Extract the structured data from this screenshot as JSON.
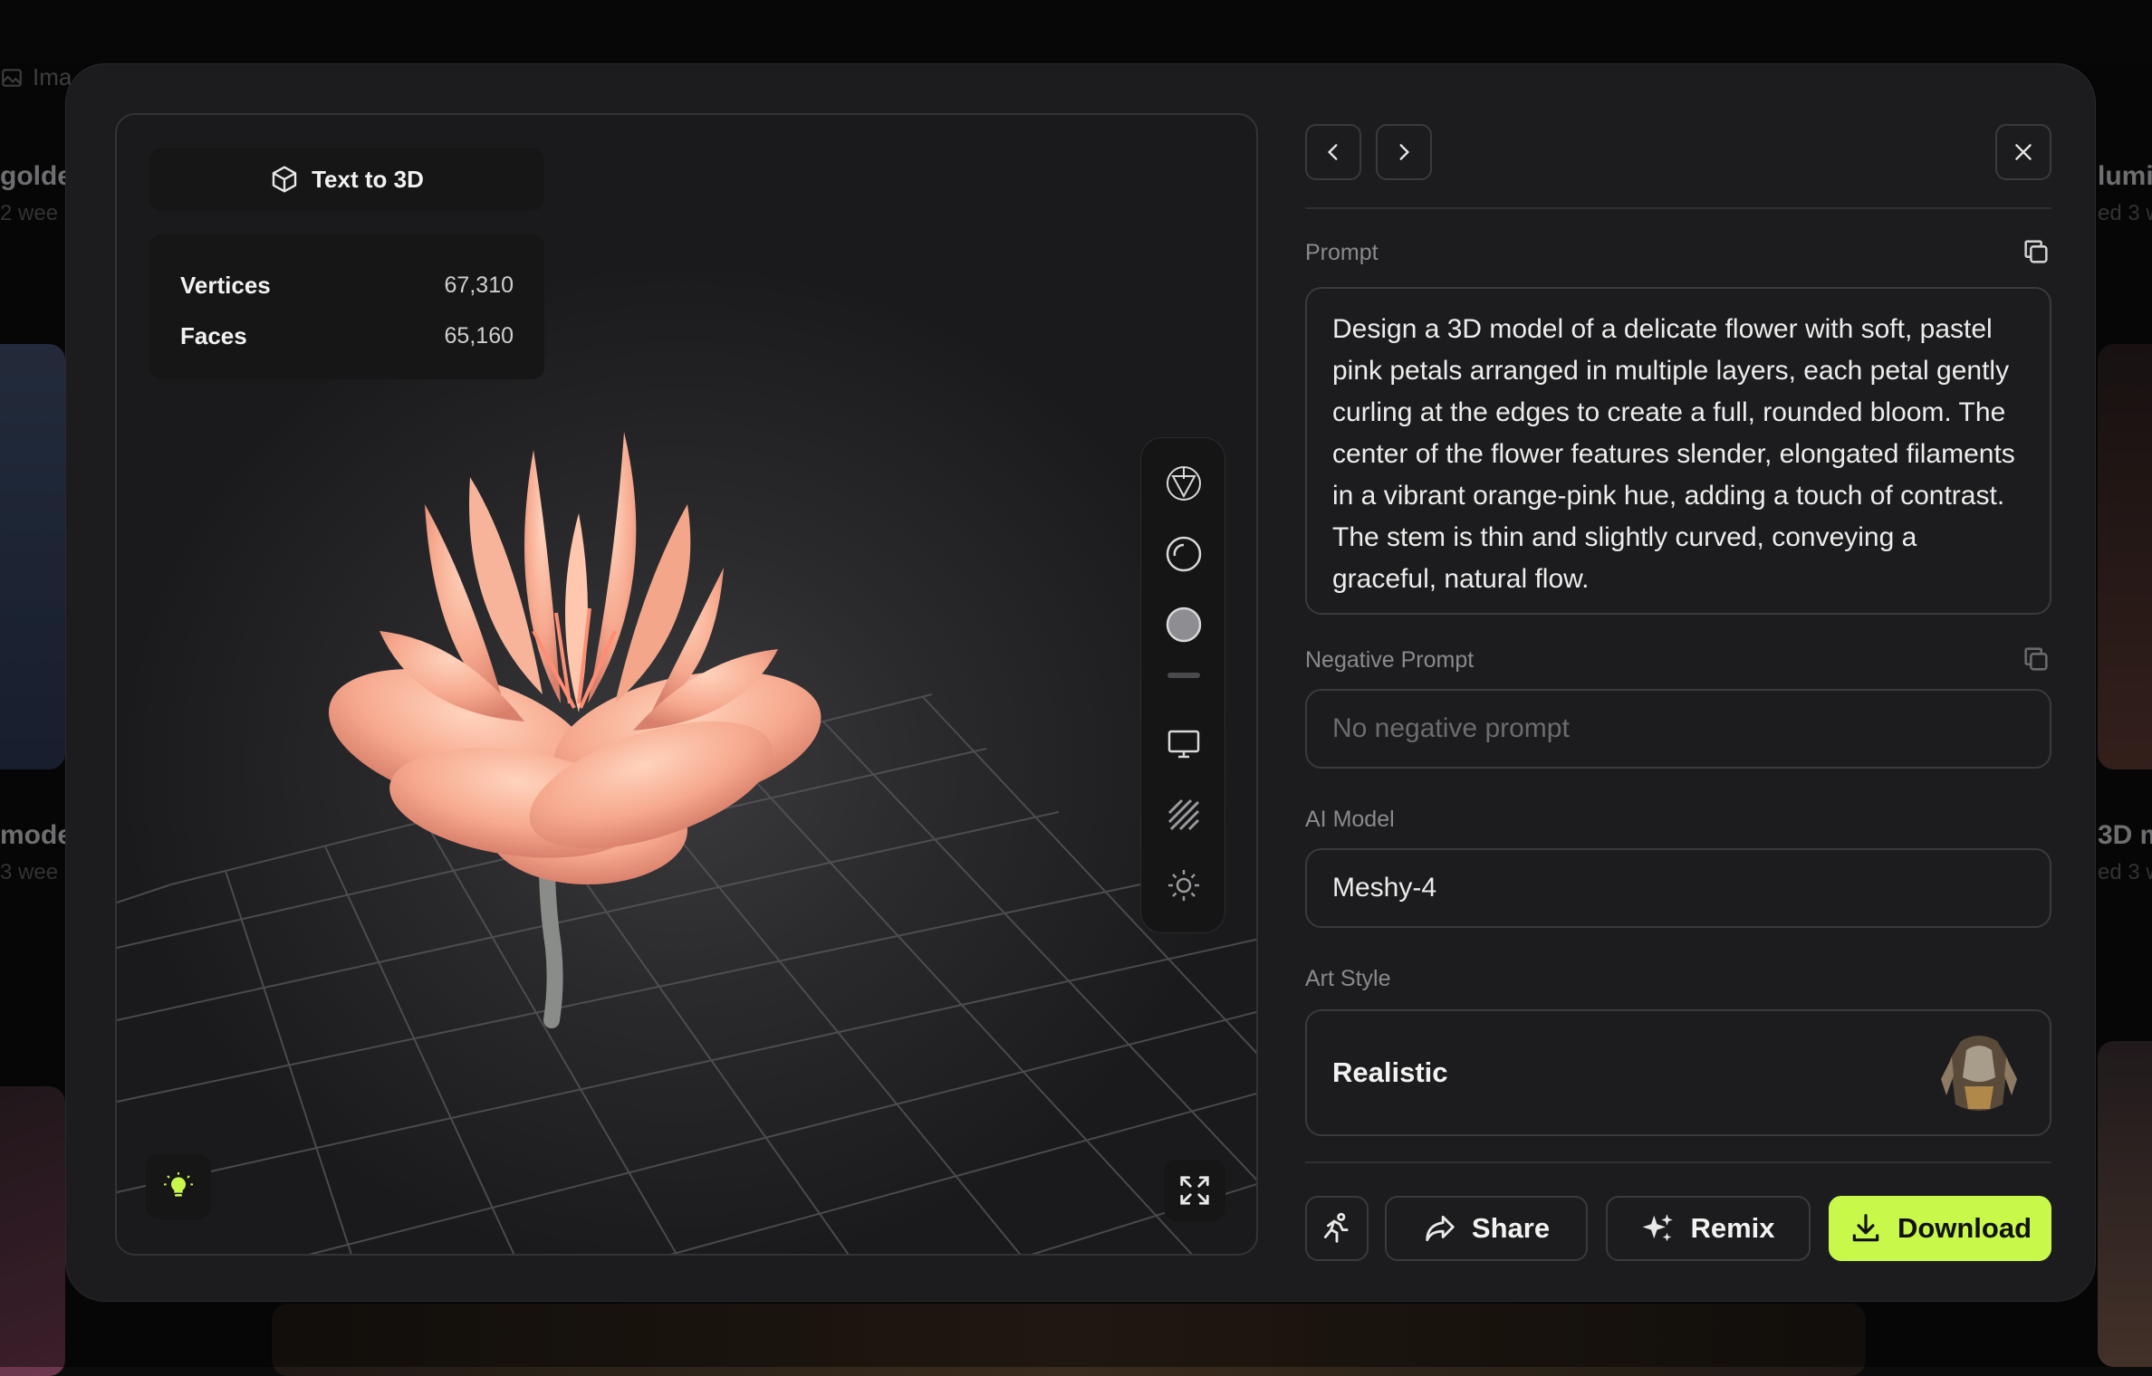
{
  "background": {
    "tab_label": "Ima",
    "cards": [
      {
        "title": "golde",
        "sub": "2 wee"
      },
      {
        "title": "mode",
        "sub": "3 wee"
      },
      {
        "title": "lumi",
        "sub": "ed 3 w"
      },
      {
        "title": "3D m",
        "sub": "ed 3 w"
      }
    ]
  },
  "viewer": {
    "mode_label": "Text to 3D",
    "mode_icon": "cube-icon",
    "stats": [
      {
        "label": "Vertices",
        "value": "67,310"
      },
      {
        "label": "Faces",
        "value": "65,160"
      }
    ],
    "tools": [
      "wireframe-sphere-icon",
      "outline-sphere-icon",
      "solid-sphere-icon",
      "separator",
      "monitor-icon",
      "hatch-icon",
      "sun-icon"
    ],
    "light_icon": "bulb-icon",
    "expand_icon": "expand-icon"
  },
  "panel": {
    "prompt_label": "Prompt",
    "prompt_text": "Design a 3D model of a delicate flower with soft, pastel pink petals arranged in multiple layers, each petal gently curling at the edges to create a full, rounded bloom. The center of the flower features slender, elongated filaments in a vibrant orange-pink hue, adding a touch of contrast. The stem is thin and slightly curved, conveying a graceful, natural flow.",
    "negative_label": "Negative Prompt",
    "negative_placeholder": "No negative prompt",
    "model_label": "AI Model",
    "model_value": "Meshy-4",
    "style_label": "Art Style",
    "style_value": "Realistic",
    "actions": {
      "share": "Share",
      "remix": "Remix",
      "download": "Download"
    }
  },
  "colors": {
    "accent": "#c7f84a",
    "modal_bg": "#1c1c1e",
    "border": "#3a3a3d"
  }
}
